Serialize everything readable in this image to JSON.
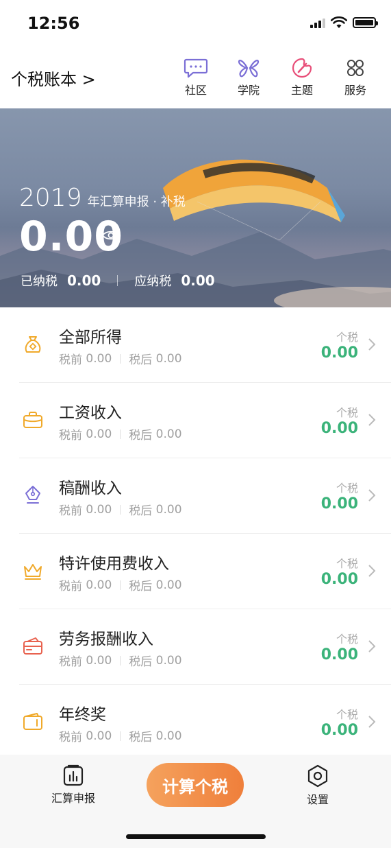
{
  "status_bar": {
    "time": "12:56"
  },
  "header": {
    "title": "个税账本 >",
    "nav": [
      {
        "label": "社区",
        "icon": "chat-bubble-icon",
        "color": "#7b6fd6"
      },
      {
        "label": "学院",
        "icon": "butterfly-icon",
        "color": "#7b6fd6"
      },
      {
        "label": "主题",
        "icon": "palette-icon",
        "color": "#e8507a"
      },
      {
        "label": "服务",
        "icon": "command-icon",
        "color": "#444444"
      }
    ]
  },
  "banner": {
    "year": "2019",
    "year_suffix": "年汇算申报 · 补税",
    "amount": "0.00",
    "paid_label": "已纳税",
    "paid_value": "0.00",
    "due_label": "应纳税",
    "due_value": "0.00"
  },
  "income_items": [
    {
      "title": "全部所得",
      "icon": "money-bag-icon",
      "icon_color": "#f0a92a",
      "pre_tax_label": "税前",
      "pre_tax": "0.00",
      "post_tax_label": "税后",
      "post_tax": "0.00",
      "tax_label": "个税",
      "tax": "0.00"
    },
    {
      "title": "工资收入",
      "icon": "briefcase-icon",
      "icon_color": "#f0a92a",
      "pre_tax_label": "税前",
      "pre_tax": "0.00",
      "post_tax_label": "税后",
      "post_tax": "0.00",
      "tax_label": "个税",
      "tax": "0.00"
    },
    {
      "title": "稿酬收入",
      "icon": "pen-nib-icon",
      "icon_color": "#7b6fd6",
      "pre_tax_label": "税前",
      "pre_tax": "0.00",
      "post_tax_label": "税后",
      "post_tax": "0.00",
      "tax_label": "个税",
      "tax": "0.00"
    },
    {
      "title": "特许使用费收入",
      "icon": "crown-icon",
      "icon_color": "#f0a92a",
      "pre_tax_label": "税前",
      "pre_tax": "0.00",
      "post_tax_label": "税后",
      "post_tax": "0.00",
      "tax_label": "个税",
      "tax": "0.00"
    },
    {
      "title": "劳务报酬收入",
      "icon": "wallet-card-icon",
      "icon_color": "#e8624f",
      "pre_tax_label": "税前",
      "pre_tax": "0.00",
      "post_tax_label": "税后",
      "post_tax": "0.00",
      "tax_label": "个税",
      "tax": "0.00"
    },
    {
      "title": "年终奖",
      "icon": "wallet-icon",
      "icon_color": "#f0a92a",
      "pre_tax_label": "税前",
      "pre_tax": "0.00",
      "post_tax_label": "税后",
      "post_tax": "0.00",
      "tax_label": "个税",
      "tax": "0.00"
    }
  ],
  "tabbar": {
    "left_label": "汇算申报",
    "center_button": "计算个税",
    "right_label": "设置"
  },
  "colors": {
    "accent_orange": "#ef7f3b",
    "tax_green": "#3bb37a"
  }
}
